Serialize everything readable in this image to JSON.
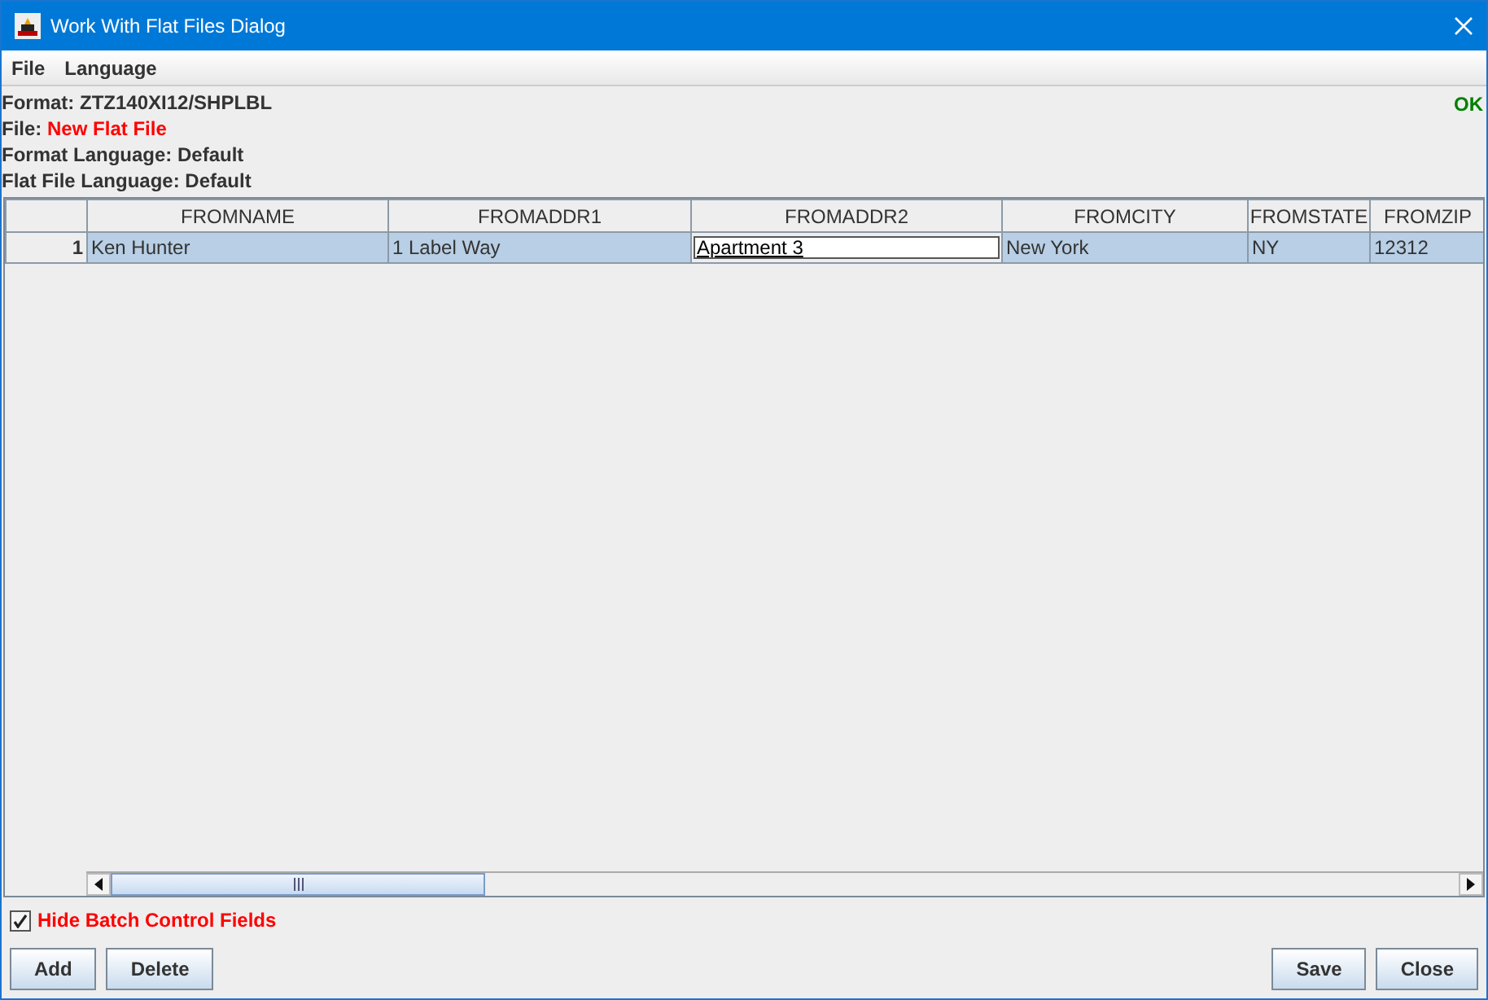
{
  "window": {
    "title": "Work With Flat Files Dialog"
  },
  "menu": [
    "File",
    "Language"
  ],
  "info": [
    {
      "label": "Format: ZTZ140XI12/SHPLBL",
      "kind": "plain"
    },
    {
      "label": "File:",
      "value": "New Flat File",
      "kind": "highlight"
    },
    {
      "label": "Format Language: Default",
      "kind": "plain"
    },
    {
      "label": "Flat File Language: Default",
      "kind": "plain"
    }
  ],
  "status": "OK",
  "table": {
    "columns": [
      "FROMNAME",
      "FROMADDR1",
      "FROMADDR2",
      "FROMCITY",
      "FROMSTATE",
      "FROMZIP"
    ],
    "rows": [
      {
        "number": "1",
        "selected": true,
        "cells": [
          {
            "text": "Ken Hunter",
            "editing": false
          },
          {
            "text": "1 Label Way",
            "editing": false
          },
          {
            "text": "Apartment 3",
            "editing": true
          },
          {
            "text": "New York",
            "editing": false
          },
          {
            "text": "NY",
            "editing": false
          },
          {
            "text": "12312",
            "editing": false
          }
        ]
      }
    ]
  },
  "hide_batch": {
    "label": "Hide Batch Control Fields",
    "checked": true
  },
  "buttons_left": [
    "Add",
    "Delete"
  ],
  "buttons_right": [
    "Save",
    "Close"
  ]
}
